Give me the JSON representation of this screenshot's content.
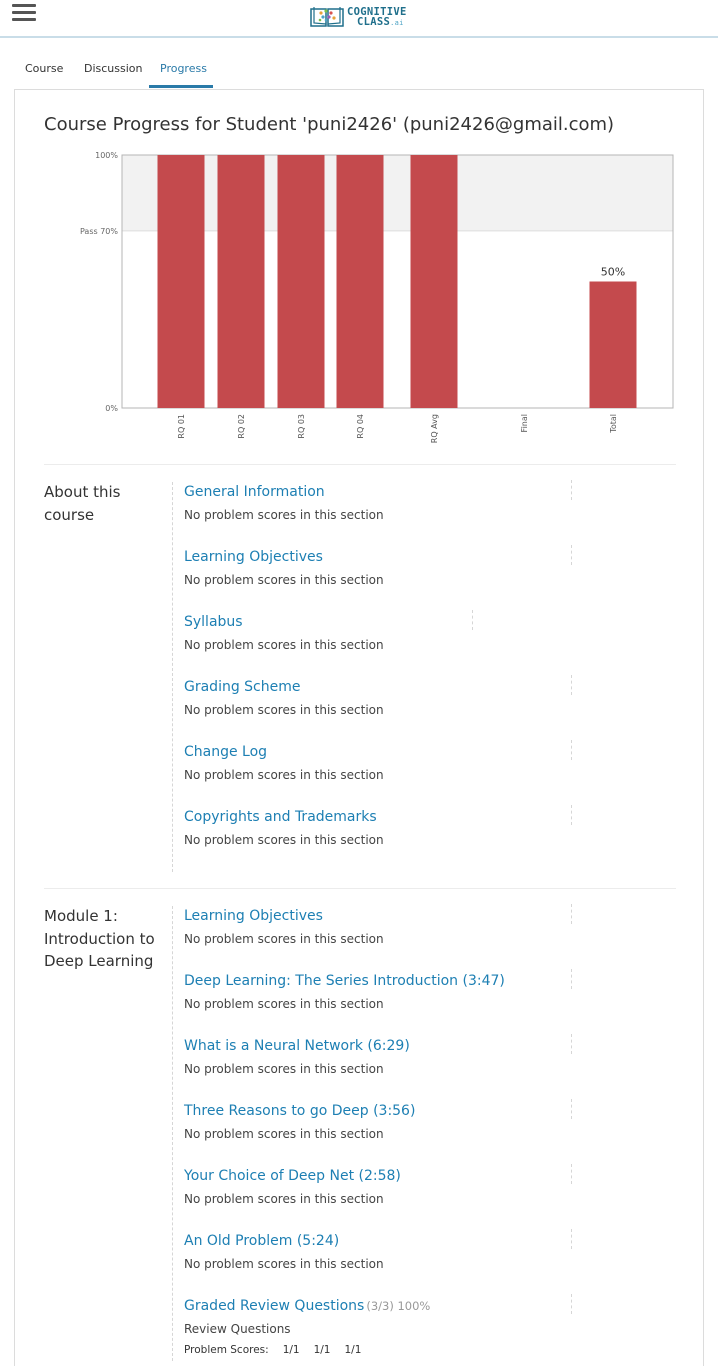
{
  "header": {
    "logo_line1": "COGNITIVE",
    "logo_line2": "CLASS",
    "logo_suffix": ".ai"
  },
  "tabs": [
    {
      "label": "Course",
      "active": false
    },
    {
      "label": "Discussion",
      "active": false
    },
    {
      "label": "Progress",
      "active": true
    }
  ],
  "page_title": "Course Progress for Student 'puni2426' (puni2426@gmail.com)",
  "colors": {
    "accent": "#2a7aa8",
    "bar": "#c44a4d",
    "link": "#1d7fb3"
  },
  "chart_data": {
    "type": "bar",
    "categories": [
      "RQ 01",
      "RQ 02",
      "RQ 03",
      "RQ 04",
      "RQ Avg",
      "Final",
      "Total"
    ],
    "values": [
      100,
      100,
      100,
      100,
      100,
      0,
      50
    ],
    "data_labels": {
      "Total": "50%"
    },
    "ylim": [
      0,
      100
    ],
    "yticks": [
      {
        "value": 0,
        "label": "0%"
      },
      {
        "value": 70,
        "label": "Pass 70%"
      },
      {
        "value": 100,
        "label": "100%"
      }
    ],
    "pass_threshold": 70,
    "grid": false
  },
  "chapters": [
    {
      "name": "About this course",
      "sections": [
        {
          "title": "General Information",
          "subtitle": "No problem scores in this section"
        },
        {
          "title": "Learning Objectives",
          "subtitle": "No problem scores in this section"
        },
        {
          "title": "Syllabus",
          "subtitle": "No problem scores in this section"
        },
        {
          "title": "Grading Scheme",
          "subtitle": "No problem scores in this section"
        },
        {
          "title": "Change Log",
          "subtitle": "No problem scores in this section"
        },
        {
          "title": "Copyrights and Trademarks",
          "subtitle": "No problem scores in this section"
        }
      ]
    },
    {
      "name": "Module 1: Introduction to Deep Learning",
      "sections": [
        {
          "title": "Learning Objectives",
          "subtitle": "No problem scores in this section"
        },
        {
          "title": "Deep Learning: The Series Introduction (3:47)",
          "subtitle": "No problem scores in this section"
        },
        {
          "title": "What is a Neural Network (6:29)",
          "subtitle": "No problem scores in this section"
        },
        {
          "title": "Three Reasons to go Deep (3:56)",
          "subtitle": "No problem scores in this section"
        },
        {
          "title": "Your Choice of Deep Net (2:58)",
          "subtitle": "No problem scores in this section"
        },
        {
          "title": "An Old Problem (5:24)",
          "subtitle": "No problem scores in this section"
        },
        {
          "title": "Graded Review Questions",
          "score": "(3/3) 100%",
          "subtitle": "Review Questions",
          "problem_scores_label": "Problem Scores:",
          "problem_scores": [
            "1/1",
            "1/1",
            "1/1"
          ]
        }
      ]
    }
  ]
}
